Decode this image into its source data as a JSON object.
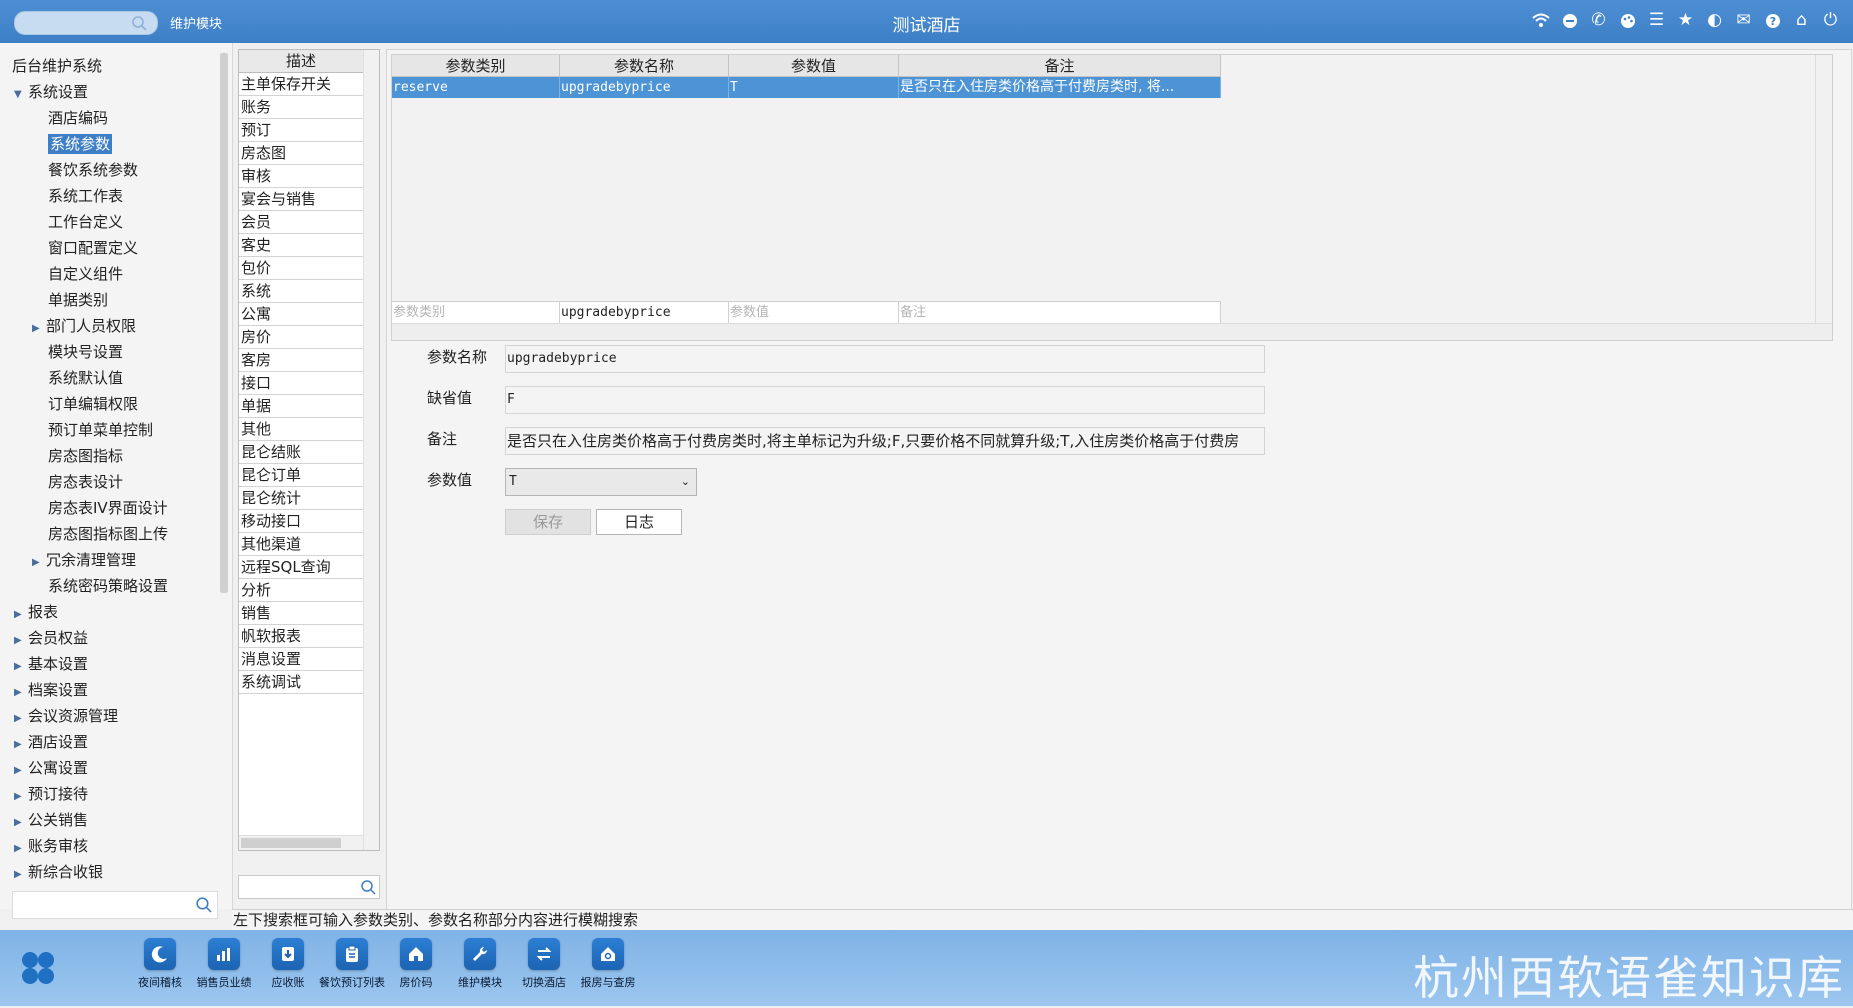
{
  "topbar": {
    "module_label": "维护模块",
    "title": "测试酒店",
    "icons": [
      "wifi-icon",
      "message-icon",
      "phone-icon",
      "palette-icon",
      "menu-icon",
      "star-icon",
      "theme-icon",
      "mail-icon",
      "help-icon",
      "home-icon",
      "power-icon"
    ]
  },
  "tree": {
    "root": "后台维护系统",
    "group_system": "系统设置",
    "children": [
      {
        "label": "酒店编码"
      },
      {
        "label": "系统参数",
        "selected": true
      },
      {
        "label": "餐饮系统参数"
      },
      {
        "label": "系统工作表"
      },
      {
        "label": "工作台定义"
      },
      {
        "label": "窗口配置定义"
      },
      {
        "label": "自定义组件"
      },
      {
        "label": "单据类别"
      },
      {
        "label": "部门人员权限",
        "expandable": true
      },
      {
        "label": "模块号设置"
      },
      {
        "label": "系统默认值"
      },
      {
        "label": "订单编辑权限"
      },
      {
        "label": "预订单菜单控制"
      },
      {
        "label": "房态图指标"
      },
      {
        "label": "房态表设计"
      },
      {
        "label": "房态表IV界面设计"
      },
      {
        "label": "房态图指标图上传"
      },
      {
        "label": "冗余清理管理",
        "expandable": true
      },
      {
        "label": "系统密码策略设置"
      }
    ],
    "groups": [
      "报表",
      "会员权益",
      "基本设置",
      "档案设置",
      "会议资源管理",
      "酒店设置",
      "公寓设置",
      "预订接待",
      "公关销售",
      "账务审核",
      "新综合收银"
    ]
  },
  "categories": {
    "header": "描述",
    "items": [
      "主单保存开关",
      "账务",
      "预订",
      "房态图",
      "审核",
      "宴会与销售",
      "会员",
      "客史",
      "包价",
      "系统",
      "公寓",
      "房价",
      "客房",
      "接口",
      "单据",
      "其他",
      "昆仑结账",
      "昆仑订单",
      "昆仑统计",
      "移动接口",
      "其他渠道",
      "远程SQL查询",
      "分析",
      "销售",
      "帆软报表",
      "消息设置",
      "系统调试"
    ]
  },
  "grid": {
    "columns": [
      "参数类别",
      "参数名称",
      "参数值",
      "备注"
    ],
    "rows": [
      {
        "category": "reserve",
        "name": "upgradebyprice",
        "value": "T",
        "remark": "是否只在入住房类价格高于付费房类时, 将..."
      }
    ],
    "filter": {
      "category_placeholder": "参数类别",
      "name_value": "upgradebyprice",
      "value_placeholder": "参数值",
      "remark_placeholder": "备注"
    }
  },
  "form": {
    "name_label": "参数名称",
    "name_value": "upgradebyprice",
    "default_label": "缺省值",
    "default_value": "F",
    "remark_label": "备注",
    "remark_value": "是否只在入住房类价格高于付费房类时,将主单标记为升级;F,只要价格不同就算升级;T,入住房类价格高于付费房",
    "param_label": "参数值",
    "param_value": "T",
    "save_label": "保存",
    "log_label": "日志"
  },
  "status_text": "左下搜索框可输入参数类别、参数名称部分内容进行模糊搜索",
  "dock": {
    "items": [
      {
        "label": "夜间稽核",
        "icon": "moon-icon"
      },
      {
        "label": "销售员业绩",
        "icon": "chart-icon"
      },
      {
        "label": "应收账",
        "icon": "download-icon"
      },
      {
        "label": "餐饮预订列表",
        "icon": "clipboard-icon"
      },
      {
        "label": "房价码",
        "icon": "house-icon"
      },
      {
        "label": "维护模块",
        "icon": "wrench-icon"
      },
      {
        "label": "切换酒店",
        "icon": "switch-icon"
      },
      {
        "label": "报房与查房",
        "icon": "house-search-icon"
      }
    ],
    "watermark": "杭州西软语雀知识库"
  }
}
